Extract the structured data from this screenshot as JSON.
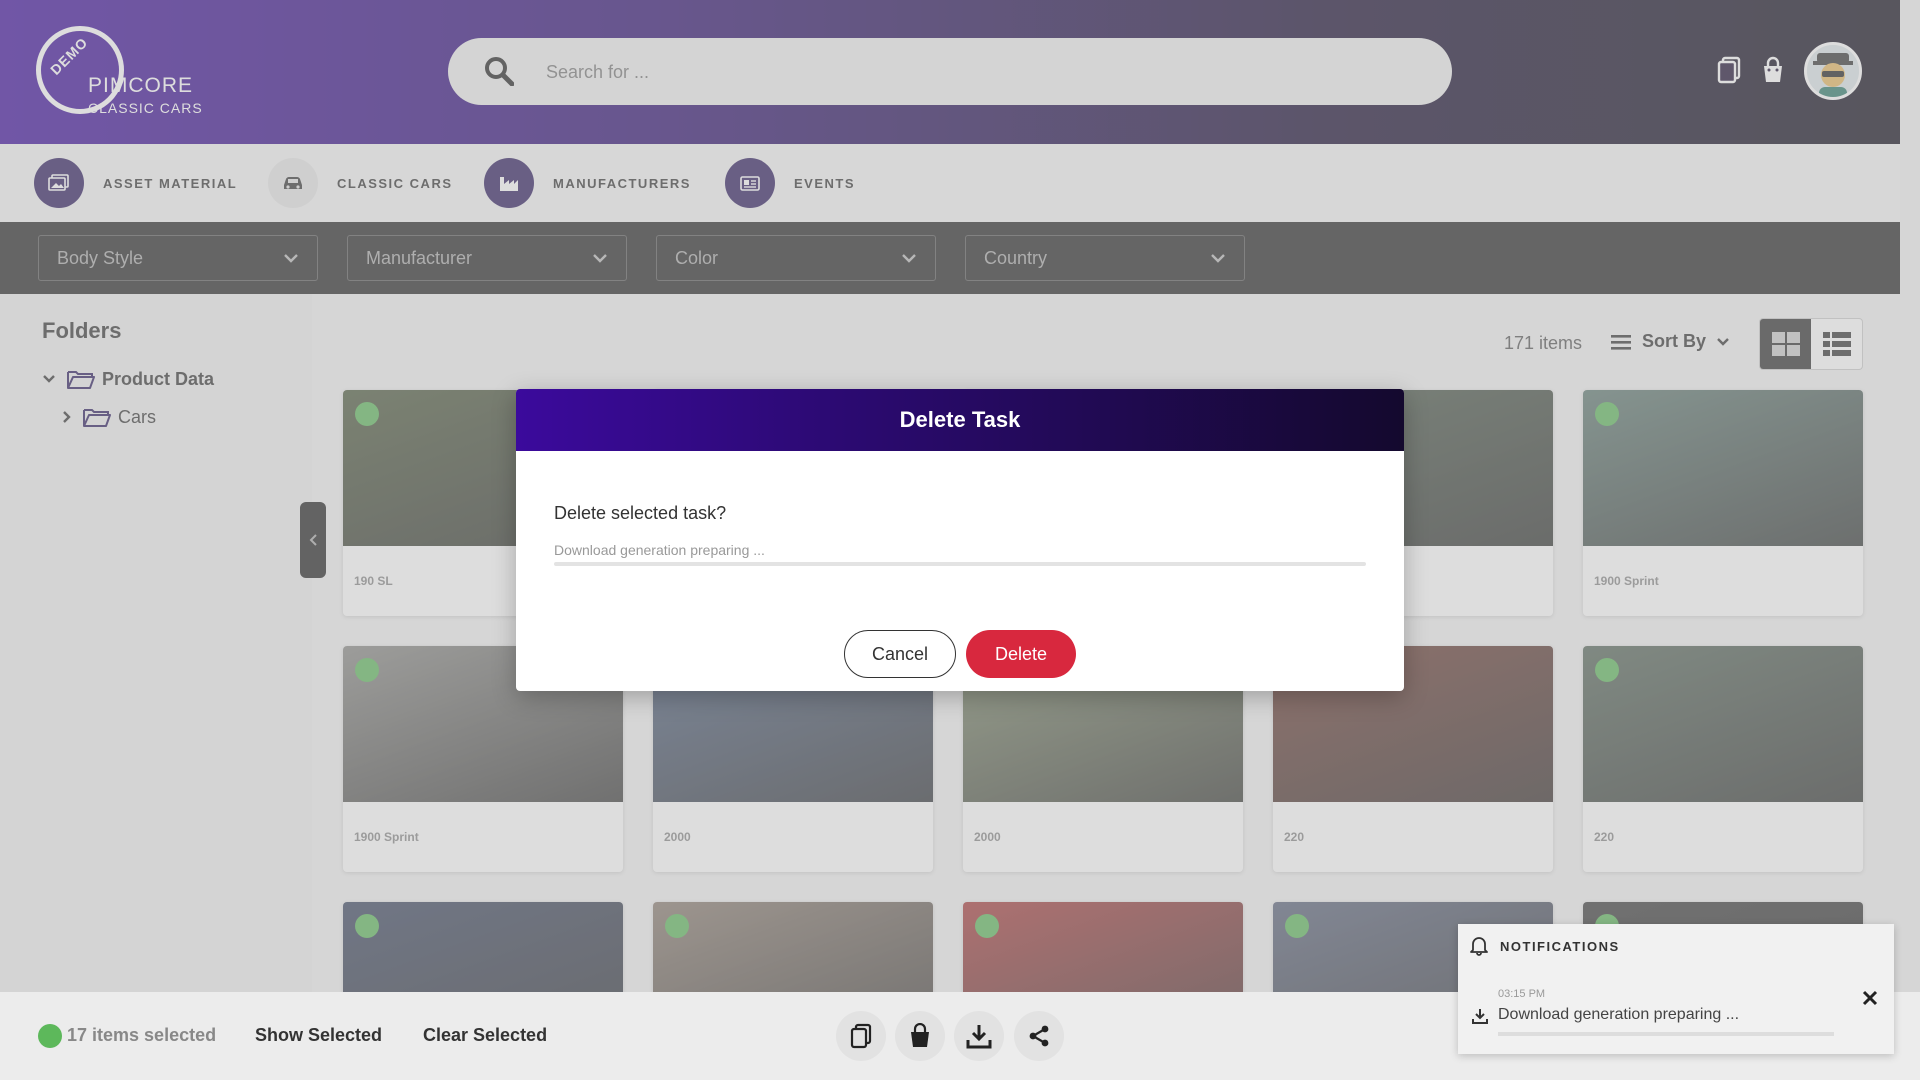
{
  "brand": {
    "badge": "DEMO",
    "name": "PIMCORE",
    "subtitle": "CLASSIC CARS"
  },
  "search": {
    "placeholder": "Search for ..."
  },
  "categories": [
    {
      "label": "ASSET MATERIAL",
      "icon": "image-gallery-icon",
      "active": false
    },
    {
      "label": "CLASSIC CARS",
      "icon": "car-icon",
      "active": true
    },
    {
      "label": "MANUFACTURERS",
      "icon": "factory-icon",
      "active": false
    },
    {
      "label": "EVENTS",
      "icon": "calendar-card-icon",
      "active": false
    }
  ],
  "filters": [
    {
      "label": "Body Style"
    },
    {
      "label": "Manufacturer"
    },
    {
      "label": "Color"
    },
    {
      "label": "Country"
    }
  ],
  "sidebar": {
    "title": "Folders",
    "tree": [
      {
        "label": "Product Data",
        "expanded": true
      },
      {
        "label": "Cars",
        "expanded": false
      }
    ]
  },
  "listing": {
    "count": "171 items",
    "sort_label": "Sort By"
  },
  "cards": [
    {
      "title": "190 SL",
      "color": "#4d5a3d"
    },
    {
      "title": "",
      "color": "#5f6b60"
    },
    {
      "title": "",
      "color": "#4a5a52"
    },
    {
      "title": "",
      "color": "#4b5a4a"
    },
    {
      "title": "1900 Sprint",
      "color": "#5f7a72"
    },
    {
      "title": "1900 Sprint",
      "color": "#8a8a86"
    },
    {
      "title": "2000",
      "color": "#4d6080"
    },
    {
      "title": "2000",
      "color": "#7d8a6a"
    },
    {
      "title": "220",
      "color": "#6e3a30"
    },
    {
      "title": "220",
      "color": "#56675a"
    },
    {
      "title": "",
      "color": "#3a4560"
    },
    {
      "title": "",
      "color": "#8a7c70"
    },
    {
      "title": "",
      "color": "#a83a3a"
    },
    {
      "title": "",
      "color": "#59627a"
    },
    {
      "title": "",
      "color": "#3a3a3a"
    }
  ],
  "modal": {
    "title": "Delete Task",
    "question": "Delete selected task?",
    "status": "Download generation preparing ...",
    "cancel_label": "Cancel",
    "delete_label": "Delete"
  },
  "bottom": {
    "selected_text": "17 items selected",
    "show_selected": "Show Selected",
    "clear_selected": "Clear Selected"
  },
  "notifications": {
    "title": "NOTIFICATIONS",
    "time": "03:15 PM",
    "message": "Download generation preparing ..."
  },
  "colors": {
    "accent_purple": "#3b0a9c",
    "delete_red": "#d8283e",
    "selected_green": "#5db85b"
  }
}
